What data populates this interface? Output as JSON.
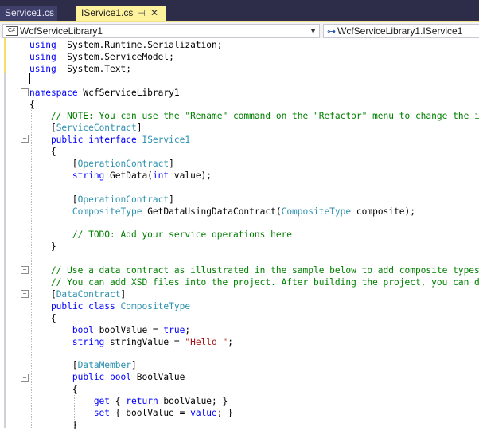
{
  "tabs": [
    {
      "label": "Service1.cs",
      "active": false
    },
    {
      "label": "IService1.cs",
      "active": true
    }
  ],
  "tab_icons": {
    "pin": "pin-icon",
    "close": "close-icon"
  },
  "navbar": {
    "left_combo": {
      "icon": "C#",
      "value": "WcfServiceLibrary1"
    },
    "right_combo": {
      "icon": "member-icon",
      "value": "WcfServiceLibrary1.IService1"
    }
  },
  "colors": {
    "keyword": "#0000ff",
    "type": "#2b91af",
    "comment": "#008000",
    "string": "#a31515",
    "active_tab": "#fff29d",
    "tab_strip": "#2d2d4a"
  },
  "code": {
    "l1": [
      [
        "kw",
        "using"
      ],
      [
        "",
        "  System.Runtime.Serialization;"
      ]
    ],
    "l2": [
      [
        "kw",
        "using"
      ],
      [
        "",
        "  System.ServiceModel;"
      ]
    ],
    "l3": [
      [
        "kw",
        "using"
      ],
      [
        "",
        "  System.Text;"
      ]
    ],
    "l4": [],
    "l5": [
      [
        "kw",
        "namespace"
      ],
      [
        "",
        " WcfServiceLibrary1"
      ]
    ],
    "l6": [
      [
        "",
        "{"
      ]
    ],
    "l7": [
      [
        "cm",
        "    // NOTE: You can use the \"Rename\" command on the \"Refactor\" menu to change the inte"
      ]
    ],
    "l8": [
      [
        "",
        "    ["
      ],
      [
        "ty",
        "ServiceContract"
      ],
      [
        "",
        "]"
      ]
    ],
    "l9": [
      [
        "kw",
        "    public interface "
      ],
      [
        "ty",
        "IService1"
      ]
    ],
    "l10": [
      [
        "",
        "    {"
      ]
    ],
    "l11": [
      [
        "",
        "        ["
      ],
      [
        "ty",
        "OperationContract"
      ],
      [
        "",
        "]"
      ]
    ],
    "l12": [
      [
        "kw",
        "        string"
      ],
      [
        "",
        " GetData("
      ],
      [
        "kw",
        "int"
      ],
      [
        "",
        " value);"
      ]
    ],
    "l13": [],
    "l14": [
      [
        "",
        "        ["
      ],
      [
        "ty",
        "OperationContract"
      ],
      [
        "",
        "]"
      ]
    ],
    "l15": [
      [
        "ty",
        "        CompositeType"
      ],
      [
        "",
        " GetDataUsingDataContract("
      ],
      [
        "ty",
        "CompositeType"
      ],
      [
        "",
        " composite);"
      ]
    ],
    "l16": [],
    "l17": [
      [
        "cm",
        "        // TODO: Add your service operations here"
      ]
    ],
    "l18": [
      [
        "",
        "    }"
      ]
    ],
    "l19": [],
    "l20": [
      [
        "cm",
        "    // Use a data contract as illustrated in the sample below to add composite types to"
      ]
    ],
    "l21": [
      [
        "cm",
        "    // You can add XSD files into the project. After building the project, you can dire"
      ]
    ],
    "l22": [
      [
        "",
        "    ["
      ],
      [
        "ty",
        "DataContract"
      ],
      [
        "",
        "]"
      ]
    ],
    "l23": [
      [
        "kw",
        "    public class "
      ],
      [
        "ty",
        "CompositeType"
      ]
    ],
    "l24": [
      [
        "",
        "    {"
      ]
    ],
    "l25": [
      [
        "kw",
        "        bool"
      ],
      [
        "",
        " boolValue = "
      ],
      [
        "kw",
        "true"
      ],
      [
        "",
        ";"
      ]
    ],
    "l26": [
      [
        "kw",
        "        string"
      ],
      [
        "",
        " stringValue = "
      ],
      [
        "st",
        "\"Hello \""
      ],
      [
        "",
        ";"
      ]
    ],
    "l27": [],
    "l28": [
      [
        "",
        "        ["
      ],
      [
        "ty",
        "DataMember"
      ],
      [
        "",
        "]"
      ]
    ],
    "l29": [
      [
        "kw",
        "        public bool"
      ],
      [
        "",
        " BoolValue"
      ]
    ],
    "l30": [
      [
        "",
        "        {"
      ]
    ],
    "l31": [
      [
        "kw",
        "            get"
      ],
      [
        "",
        " { "
      ],
      [
        "kw",
        "return"
      ],
      [
        "",
        " boolValue; }"
      ]
    ],
    "l32": [
      [
        "kw",
        "            set"
      ],
      [
        "",
        " { boolValue = "
      ],
      [
        "kw",
        "value"
      ],
      [
        "",
        "; }"
      ]
    ],
    "l33": [
      [
        "",
        "        }"
      ]
    ]
  }
}
